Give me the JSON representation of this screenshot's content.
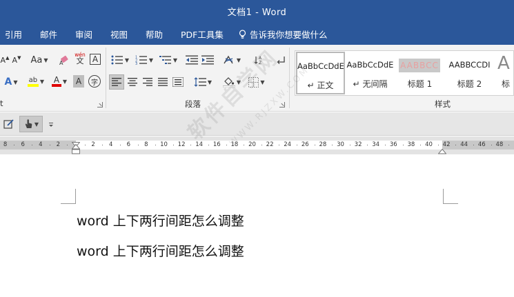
{
  "window": {
    "title": "文档1  -  Word"
  },
  "tabs": [
    {
      "label": "引用"
    },
    {
      "label": "邮件"
    },
    {
      "label": "审阅"
    },
    {
      "label": "视图"
    },
    {
      "label": "帮助"
    },
    {
      "label": "PDF工具集"
    }
  ],
  "tell_me": {
    "label": "告诉我你想要做什么"
  },
  "ribbon": {
    "font_group_partial_label": "t",
    "change_case_label": "Aa",
    "phonetic_label": "wén",
    "phonetic_char": "文",
    "char_border_label": "A",
    "paragraph_group_label": "段落",
    "styles_group_label": "样式",
    "styles": [
      {
        "sample": "AaBbCcDdE",
        "name": "正文",
        "prefix": "↵",
        "selected": true
      },
      {
        "sample": "AaBbCcDdE",
        "name": "无间隔",
        "prefix": "↵",
        "selected": false
      },
      {
        "sample": "AABBCC",
        "name": "标题 1",
        "prefix": "",
        "selected": false
      },
      {
        "sample": "AABBCCDI",
        "name": "标题 2",
        "prefix": "",
        "selected": false
      },
      {
        "sample": "A",
        "name": "标",
        "prefix": "",
        "selected": false
      }
    ]
  },
  "ruler": {
    "left_ticks": [
      "8",
      "6",
      "4",
      "2"
    ],
    "ticks": [
      "2",
      "4",
      "6",
      "8",
      "10",
      "12",
      "14",
      "16",
      "18",
      "20",
      "22",
      "24",
      "26",
      "28",
      "30",
      "32",
      "34",
      "36",
      "38",
      "40",
      "42",
      "44",
      "46",
      "48"
    ]
  },
  "document": {
    "paragraphs": [
      "word 上下两行间距怎么调整",
      "word 上下两行间距怎么调整"
    ]
  },
  "watermark": {
    "text": "软件自学网",
    "subtext": "WWW.RJZXW.COM"
  },
  "colors": {
    "title_bar": "#2b579a",
    "ribbon_bg": "#f3f3f3",
    "highlight": "#ffff00",
    "font_color": "#e00000",
    "heading1_sample": "#e8a0a0"
  }
}
